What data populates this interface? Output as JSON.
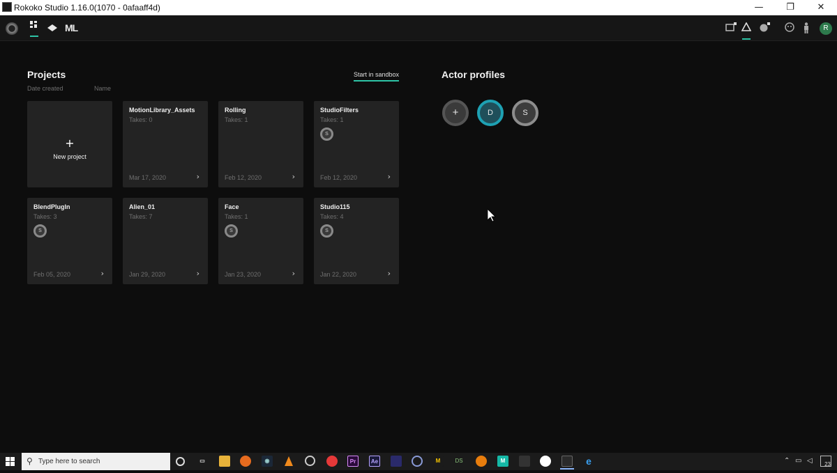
{
  "window": {
    "title": "Rokoko Studio 1.16.0(1070 - 0afaaff4d)",
    "minimize": "—",
    "restore": "❐",
    "close": "✕"
  },
  "toolbar": {
    "left_icons": [
      "rokoko-logo-icon",
      "projects-grid-icon",
      "library-icon",
      "ml-icon"
    ],
    "ml_label": "ML",
    "right_icons": [
      "device-locked-icon",
      "warning-icon",
      "sensor-locked-icon",
      "face-icon",
      "body-icon",
      "user-avatar-icon"
    ],
    "avatar_initial": "R",
    "accent_color": "#2ec4a6"
  },
  "projects": {
    "title": "Projects",
    "sort_date": "Date created",
    "sort_name": "Name",
    "sandbox_link": "Start in sandbox",
    "new_project": {
      "plus": "+",
      "label": "New project"
    },
    "cards": [
      {
        "name": "MotionLibrary_Assets",
        "takes": "Takes: 0",
        "badge": "",
        "date": "Mar 17, 2020"
      },
      {
        "name": "Rolling",
        "takes": "Takes: 1",
        "badge": "",
        "date": "Feb 12, 2020"
      },
      {
        "name": "StudioFilters",
        "takes": "Takes: 1",
        "badge": "S",
        "date": "Feb 12, 2020"
      },
      {
        "name": "BlendPlugIn",
        "takes": "Takes: 3",
        "badge": "S",
        "date": "Feb 05, 2020"
      },
      {
        "name": "Alien_01",
        "takes": "Takes: 7",
        "badge": "",
        "date": "Jan 29, 2020"
      },
      {
        "name": "Face",
        "takes": "Takes: 1",
        "badge": "S",
        "date": "Jan 23, 2020"
      },
      {
        "name": "Studio115",
        "takes": "Takes: 4",
        "badge": "S",
        "date": "Jan 22, 2020"
      }
    ]
  },
  "actors": {
    "title": "Actor profiles",
    "add": "+",
    "profiles": [
      {
        "initial": "D",
        "color": "#1ea1b3"
      },
      {
        "initial": "S",
        "color": "#8d8d8d"
      }
    ]
  },
  "taskbar": {
    "search_placeholder": "Type here to search",
    "apps": [
      "task-view-icon",
      "file-explorer-icon",
      "firefox-icon",
      "steam-icon",
      "vlc-icon",
      "obs-icon",
      "creative-cloud-icon",
      "premiere-icon",
      "after-effects-icon",
      "app-icon",
      "cinema4d-icon",
      "m-app-icon",
      "ds-icon",
      "blender-icon",
      "m-green-icon",
      "unity-icon",
      "slack-icon",
      "rokoko-icon",
      "edge-icon"
    ],
    "labels": {
      "premiere": "Pr",
      "after_effects": "Ae",
      "m_app": "M",
      "ds": "DS",
      "m_green": "M"
    },
    "notification_count": "23"
  }
}
